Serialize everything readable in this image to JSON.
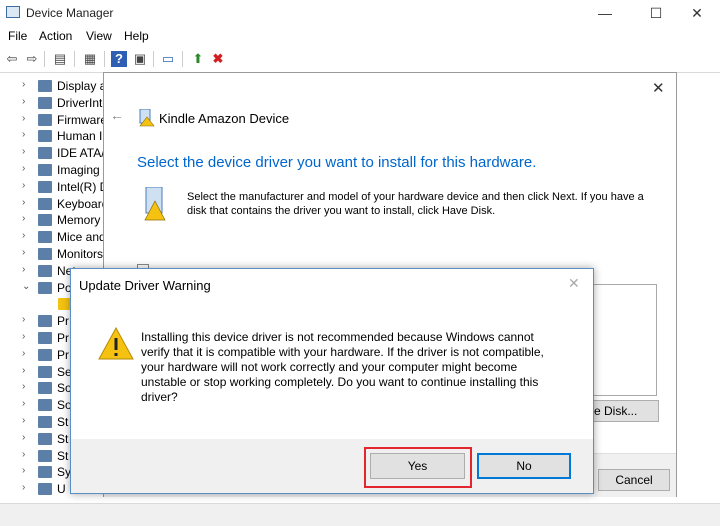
{
  "window": {
    "title": "Device Manager",
    "controls": {
      "minimize": "—",
      "maximize": "☐",
      "close": "✕"
    }
  },
  "menu": [
    "File",
    "Action",
    "View",
    "Help"
  ],
  "tree": [
    {
      "label": "Display a",
      "chev": "›"
    },
    {
      "label": "DriverInte",
      "chev": "›"
    },
    {
      "label": "Firmware",
      "chev": "›"
    },
    {
      "label": "Human In",
      "chev": "›"
    },
    {
      "label": "IDE ATA/",
      "chev": "›"
    },
    {
      "label": "Imaging d",
      "chev": "›"
    },
    {
      "label": "Intel(R) D",
      "chev": "›"
    },
    {
      "label": "Keyboard",
      "chev": "›"
    },
    {
      "label": "Memory t",
      "chev": "›"
    },
    {
      "label": "Mice and",
      "chev": "›"
    },
    {
      "label": "Monitors",
      "chev": "›"
    },
    {
      "label": "Netwo",
      "chev": "›"
    },
    {
      "label": "Po",
      "chev": "⌄"
    },
    {
      "label": "",
      "chev": ""
    },
    {
      "label": "Pr",
      "chev": "›"
    },
    {
      "label": "Pr",
      "chev": "›"
    },
    {
      "label": "Pr",
      "chev": "›"
    },
    {
      "label": "Se",
      "chev": "›"
    },
    {
      "label": "So",
      "chev": "›"
    },
    {
      "label": "So",
      "chev": "›"
    },
    {
      "label": "St",
      "chev": "›"
    },
    {
      "label": "St",
      "chev": "›"
    },
    {
      "label": "St",
      "chev": "›"
    },
    {
      "label": "Sy",
      "chev": "›"
    },
    {
      "label": "U",
      "chev": "›"
    }
  ],
  "wizard": {
    "device_name": "Kindle Amazon Device",
    "heading": "Select the device driver you want to install for this hardware.",
    "description": "Select the manufacturer and model of your hardware device and then click Next. If you have a disk that contains the driver you want to install, click Have Disk.",
    "have_disk_label": "e Disk...",
    "cancel_label": "Cancel",
    "close_glyph": "✕",
    "back_glyph": "←"
  },
  "warning": {
    "title": "Update Driver Warning",
    "message": "Installing this device driver is not recommended because Windows cannot verify that it is compatible with your hardware.  If the driver is not compatible, your hardware will not work correctly and your computer might become unstable or stop working completely.  Do you want to continue installing this driver?",
    "yes_label": "Yes",
    "no_label": "No",
    "close_glyph": "✕",
    "icon_glyph": "!"
  },
  "colors": {
    "accent_heading": "#0066cc",
    "highlight": "#e3262d",
    "warning_yellow": "#f5c211"
  }
}
